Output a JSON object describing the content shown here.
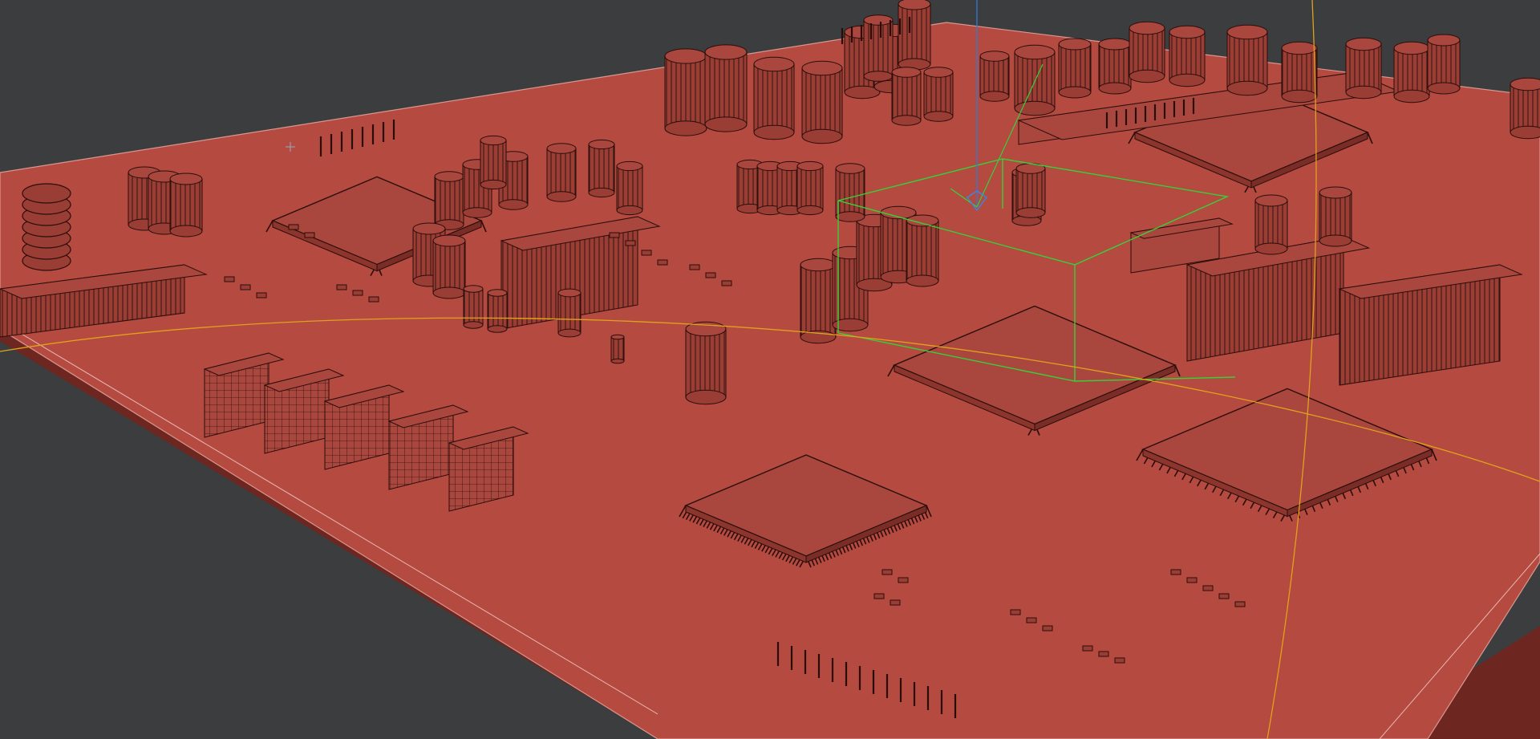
{
  "viewport": {
    "background_color": "#3b3d3f",
    "board_color": "#b44a40",
    "board_edge_color": "#8a3028",
    "board_side_color": "#6e2620",
    "wire_color": "#2a0d0a",
    "component_fill": "#9a3d34",
    "component_top": "#a9473e",
    "selection_box_color": "#36d13a",
    "gizmo_axis_color": "#2f7bd6",
    "curve_color": "#e0a21c",
    "icons": [
      "cursor-crosshair-icon",
      "transform-gizmo-icon"
    ]
  }
}
